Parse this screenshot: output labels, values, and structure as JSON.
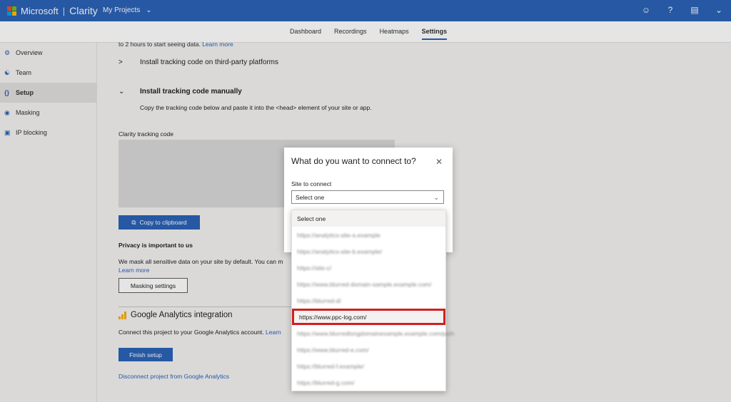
{
  "app": {
    "brand_name": "Microsoft",
    "product_name": "Clarity",
    "projects_label": "My Projects",
    "logo_colors": [
      "#f25022",
      "#7fba00",
      "#00a4ef",
      "#ffb900"
    ],
    "accent": "#2b63b6",
    "top_icons": [
      "smiley-icon",
      "help-icon",
      "document-icon",
      "chevron-down-icon"
    ]
  },
  "tabs": [
    {
      "label": "Dashboard",
      "active": false
    },
    {
      "label": "Recordings",
      "active": false
    },
    {
      "label": "Heatmaps",
      "active": false
    },
    {
      "label": "Settings",
      "active": true
    }
  ],
  "sidebar": {
    "items": [
      {
        "label": "Overview",
        "icon": "gear-icon",
        "active": false
      },
      {
        "label": "Team",
        "icon": "team-icon",
        "active": false
      },
      {
        "label": "Setup",
        "icon": "code-braces-icon",
        "active": true
      },
      {
        "label": "Masking",
        "icon": "eye-icon",
        "active": false
      },
      {
        "label": "IP blocking",
        "icon": "monitor-block-icon",
        "active": false
      }
    ]
  },
  "main": {
    "top_text": "to 2 hours to start seeing data.",
    "top_link": "Learn more",
    "third_party_label": "Install tracking code on third-party platforms",
    "manual_label": "Install tracking code manually",
    "manual_instructions": "Copy the tracking code below and paste it into the <head> element of your site or app.",
    "code_label": "Clarity tracking code",
    "copy_button": "Copy to clipboard",
    "privacy_title": "Privacy is important to us",
    "privacy_text": "We mask all sensitive data on your site by default. You can m",
    "privacy_link": "Learn more",
    "masking_button": "Masking settings",
    "ga_title": "Google Analytics integration",
    "ga_text": "Connect this project to your Google Analytics account.",
    "ga_text_link": "Learn",
    "finish_button": "Finish setup",
    "disconnect_link": "Disconnect project from Google Analytics"
  },
  "modal": {
    "title": "What do you want to connect to?",
    "field_label": "Site to connect",
    "select_value": "Select one",
    "options": [
      {
        "label": "Select one",
        "state": "first"
      },
      {
        "label": "https://analytics-site-a.example",
        "state": "blurred"
      },
      {
        "label": "https://analytics-site-b.example/",
        "state": "blurred"
      },
      {
        "label": "https://site-c/",
        "state": "blurred"
      },
      {
        "label": "https://www.blurred-domain-sample.example.com/",
        "state": "blurred"
      },
      {
        "label": "https://blurred-d/",
        "state": "blurred"
      },
      {
        "label": "https://www.ppc-log.com/",
        "state": "highlighted"
      },
      {
        "label": "https://www.blurredlongdomainexample.example.com/path",
        "state": "blurred"
      },
      {
        "label": "https://www.blurred-e.com/",
        "state": "blurred"
      },
      {
        "label": "https://blurred-f.example/",
        "state": "blurred"
      },
      {
        "label": "https://blurred-g.com/",
        "state": "blurred"
      }
    ]
  }
}
